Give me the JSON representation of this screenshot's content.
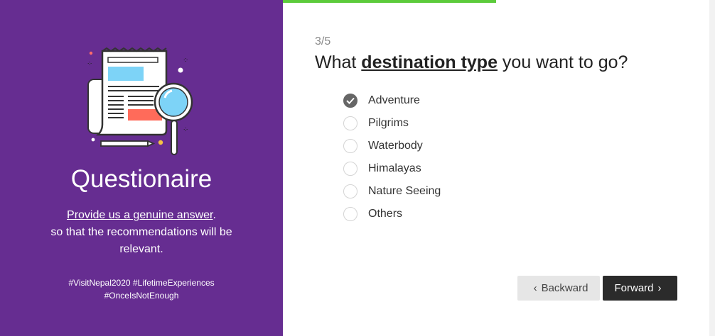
{
  "sidebar": {
    "title": "Questionaire",
    "subtitle_link": "Provide us a genuine answer",
    "subtitle_rest_1": ".",
    "subtitle_rest_2": "so that the recommendations will be",
    "subtitle_rest_3": "relevant.",
    "hashtags_line1": "#VisitNepal2020 #LifetimeExperiences",
    "hashtags_line2": "#OnceIsNotEnough",
    "illustration_icon": "newspaper-magnifier-icon"
  },
  "progress": {
    "fraction": 0.5,
    "color": "#5ccb3b"
  },
  "question": {
    "step": "3/5",
    "prefix": "What ",
    "highlight": "destination type",
    "suffix": " you want to go?"
  },
  "options": [
    {
      "label": "Adventure",
      "checked": true
    },
    {
      "label": "Pilgrims",
      "checked": false
    },
    {
      "label": "Waterbody",
      "checked": false
    },
    {
      "label": "Himalayas",
      "checked": false
    },
    {
      "label": "Nature Seeing",
      "checked": false
    },
    {
      "label": "Others",
      "checked": false
    }
  ],
  "buttons": {
    "back_label": "Backward",
    "forward_label": "Forward"
  },
  "colors": {
    "sidebar_bg": "#662d91",
    "forward_bg": "#2b2b2b",
    "back_bg": "#e6e6e6"
  }
}
